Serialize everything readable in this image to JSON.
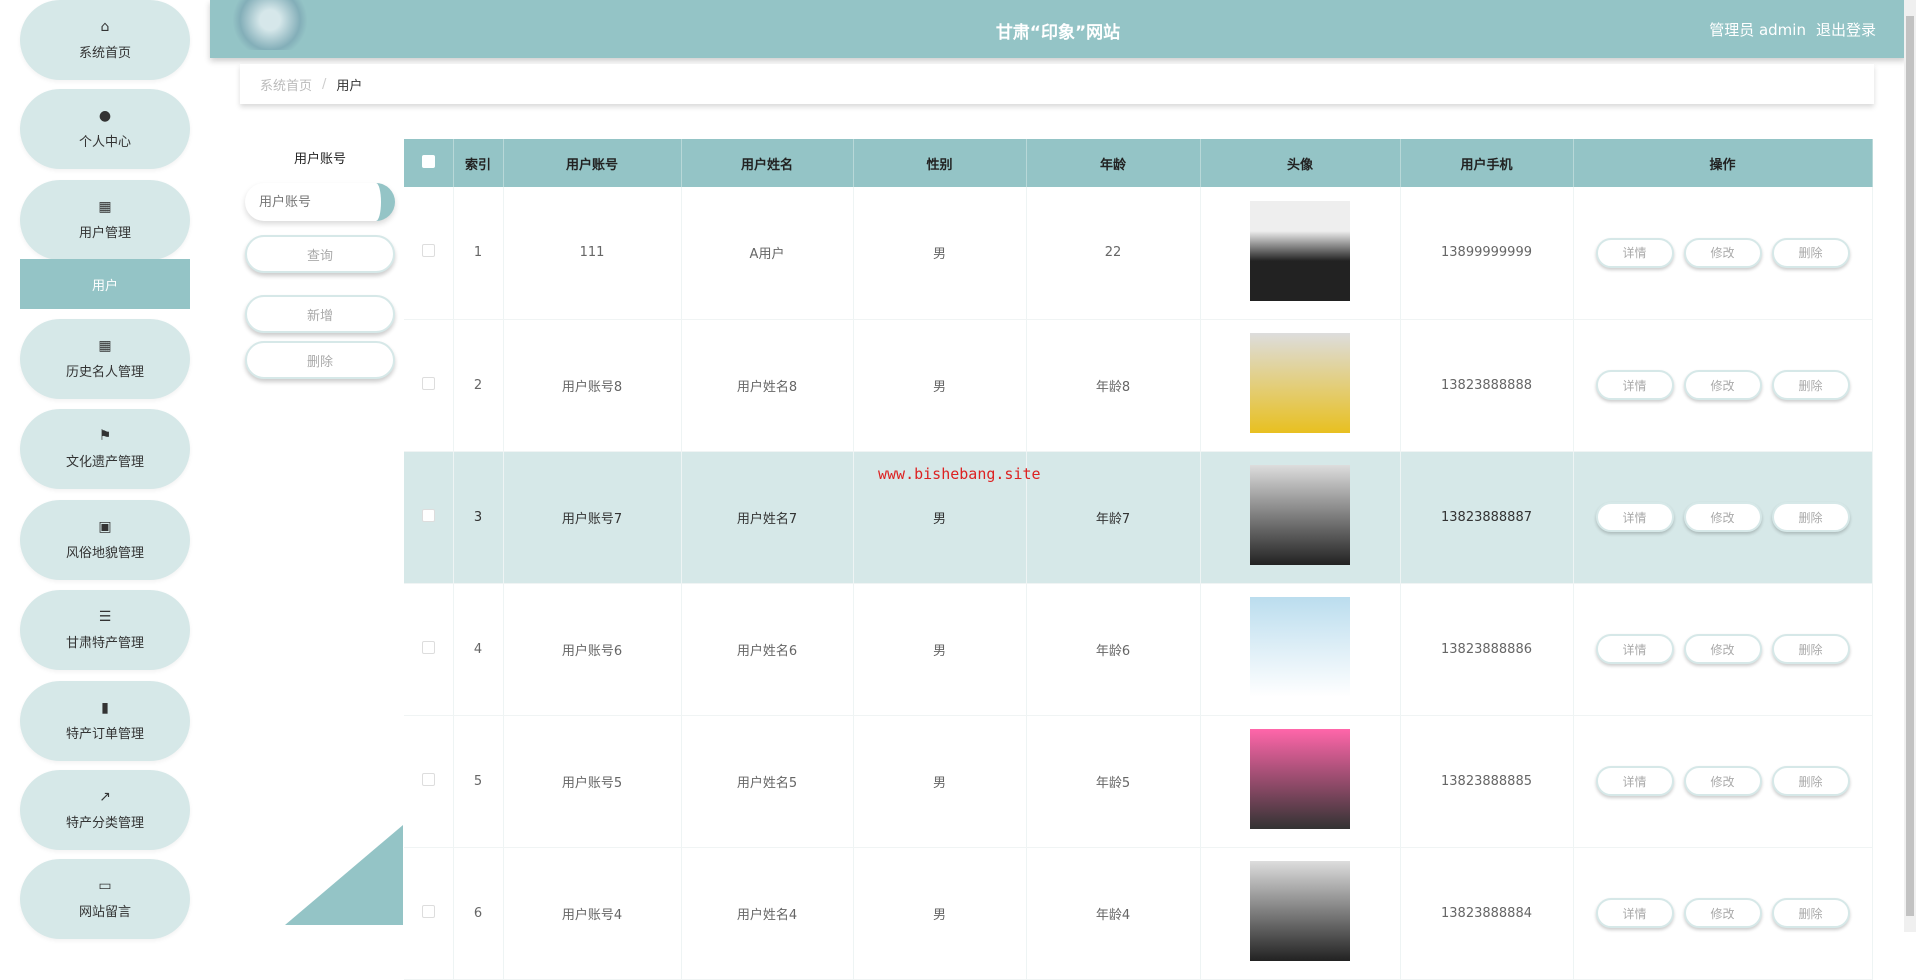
{
  "header": {
    "title": "甘肃“印象”网站",
    "user": "管理员 admin",
    "logout": "退出登录"
  },
  "sidebar": {
    "items": [
      {
        "icon": "home-icon",
        "glyph": "⌂",
        "label": "系统首页"
      },
      {
        "icon": "user-icon",
        "glyph": "●",
        "label": "个人中心"
      },
      {
        "icon": "grid-icon",
        "glyph": "▦",
        "label": "用户管理"
      },
      {
        "icon": "grid-icon",
        "glyph": "▦",
        "label": "历史名人管理"
      },
      {
        "icon": "flag-icon",
        "glyph": "⚑",
        "label": "文化遗产管理"
      },
      {
        "icon": "briefcase-icon",
        "glyph": "▣",
        "label": "风俗地貌管理"
      },
      {
        "icon": "sliders-icon",
        "glyph": "☰",
        "label": "甘肃特产管理"
      },
      {
        "icon": "book-icon",
        "glyph": "▮",
        "label": "特产订单管理"
      },
      {
        "icon": "chart-icon",
        "glyph": "↗",
        "label": "特产分类管理"
      },
      {
        "icon": "monitor-icon",
        "glyph": "▭",
        "label": "网站留言"
      }
    ],
    "sub": "用户"
  },
  "breadcrumb": {
    "home": "系统首页",
    "sep": "/",
    "current": "用户"
  },
  "search": {
    "label": "用户账号",
    "placeholder": "用户账号",
    "query": "查询",
    "add": "新增",
    "delete": "删除"
  },
  "table": {
    "headers": [
      "索引",
      "用户账号",
      "用户姓名",
      "性别",
      "年龄",
      "头像",
      "用户手机",
      "操作"
    ],
    "rows": [
      [
        "1",
        "111",
        "A用户",
        "男",
        "22",
        "13899999999"
      ],
      [
        "2",
        "用户账号8",
        "用户姓名8",
        "男",
        "年龄8",
        "13823888888"
      ],
      [
        "3",
        "用户账号7",
        "用户姓名7",
        "男",
        "年龄7",
        "13823888887"
      ],
      [
        "4",
        "用户账号6",
        "用户姓名6",
        "男",
        "年龄6",
        "13823888886"
      ],
      [
        "5",
        "用户账号5",
        "用户姓名5",
        "男",
        "年龄5",
        "13823888885"
      ],
      [
        "6",
        "用户账号4",
        "用户姓名4",
        "男",
        "年龄4",
        "13823888884"
      ]
    ],
    "actions": [
      "详情",
      "修改",
      "删除"
    ]
  },
  "watermark": "www.bishebang.site"
}
